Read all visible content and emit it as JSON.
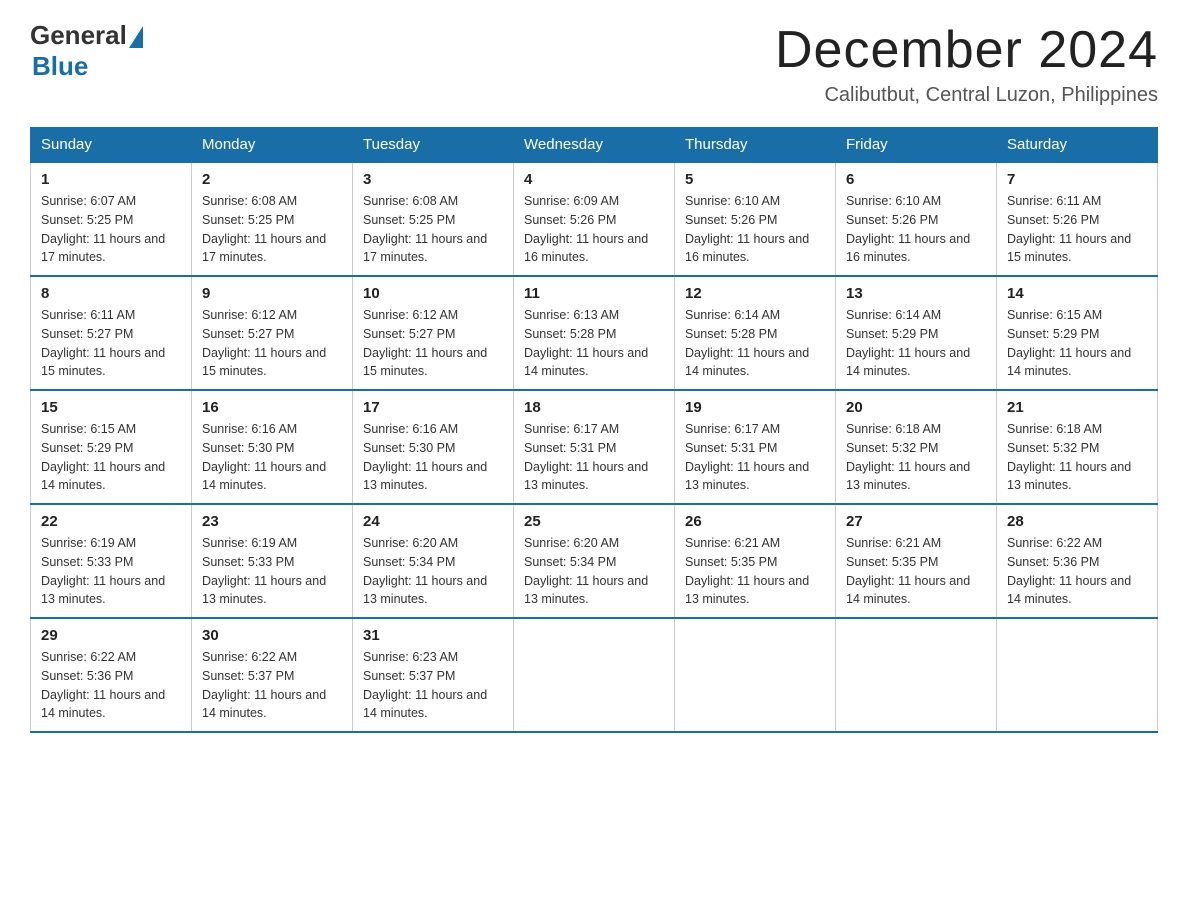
{
  "logo": {
    "general": "General",
    "blue": "Blue"
  },
  "header": {
    "month": "December 2024",
    "location": "Calibutbut, Central Luzon, Philippines"
  },
  "weekdays": [
    "Sunday",
    "Monday",
    "Tuesday",
    "Wednesday",
    "Thursday",
    "Friday",
    "Saturday"
  ],
  "weeks": [
    [
      {
        "day": "1",
        "sunrise": "6:07 AM",
        "sunset": "5:25 PM",
        "daylight": "11 hours and 17 minutes."
      },
      {
        "day": "2",
        "sunrise": "6:08 AM",
        "sunset": "5:25 PM",
        "daylight": "11 hours and 17 minutes."
      },
      {
        "day": "3",
        "sunrise": "6:08 AM",
        "sunset": "5:25 PM",
        "daylight": "11 hours and 17 minutes."
      },
      {
        "day": "4",
        "sunrise": "6:09 AM",
        "sunset": "5:26 PM",
        "daylight": "11 hours and 16 minutes."
      },
      {
        "day": "5",
        "sunrise": "6:10 AM",
        "sunset": "5:26 PM",
        "daylight": "11 hours and 16 minutes."
      },
      {
        "day": "6",
        "sunrise": "6:10 AM",
        "sunset": "5:26 PM",
        "daylight": "11 hours and 16 minutes."
      },
      {
        "day": "7",
        "sunrise": "6:11 AM",
        "sunset": "5:26 PM",
        "daylight": "11 hours and 15 minutes."
      }
    ],
    [
      {
        "day": "8",
        "sunrise": "6:11 AM",
        "sunset": "5:27 PM",
        "daylight": "11 hours and 15 minutes."
      },
      {
        "day": "9",
        "sunrise": "6:12 AM",
        "sunset": "5:27 PM",
        "daylight": "11 hours and 15 minutes."
      },
      {
        "day": "10",
        "sunrise": "6:12 AM",
        "sunset": "5:27 PM",
        "daylight": "11 hours and 15 minutes."
      },
      {
        "day": "11",
        "sunrise": "6:13 AM",
        "sunset": "5:28 PM",
        "daylight": "11 hours and 14 minutes."
      },
      {
        "day": "12",
        "sunrise": "6:14 AM",
        "sunset": "5:28 PM",
        "daylight": "11 hours and 14 minutes."
      },
      {
        "day": "13",
        "sunrise": "6:14 AM",
        "sunset": "5:29 PM",
        "daylight": "11 hours and 14 minutes."
      },
      {
        "day": "14",
        "sunrise": "6:15 AM",
        "sunset": "5:29 PM",
        "daylight": "11 hours and 14 minutes."
      }
    ],
    [
      {
        "day": "15",
        "sunrise": "6:15 AM",
        "sunset": "5:29 PM",
        "daylight": "11 hours and 14 minutes."
      },
      {
        "day": "16",
        "sunrise": "6:16 AM",
        "sunset": "5:30 PM",
        "daylight": "11 hours and 14 minutes."
      },
      {
        "day": "17",
        "sunrise": "6:16 AM",
        "sunset": "5:30 PM",
        "daylight": "11 hours and 13 minutes."
      },
      {
        "day": "18",
        "sunrise": "6:17 AM",
        "sunset": "5:31 PM",
        "daylight": "11 hours and 13 minutes."
      },
      {
        "day": "19",
        "sunrise": "6:17 AM",
        "sunset": "5:31 PM",
        "daylight": "11 hours and 13 minutes."
      },
      {
        "day": "20",
        "sunrise": "6:18 AM",
        "sunset": "5:32 PM",
        "daylight": "11 hours and 13 minutes."
      },
      {
        "day": "21",
        "sunrise": "6:18 AM",
        "sunset": "5:32 PM",
        "daylight": "11 hours and 13 minutes."
      }
    ],
    [
      {
        "day": "22",
        "sunrise": "6:19 AM",
        "sunset": "5:33 PM",
        "daylight": "11 hours and 13 minutes."
      },
      {
        "day": "23",
        "sunrise": "6:19 AM",
        "sunset": "5:33 PM",
        "daylight": "11 hours and 13 minutes."
      },
      {
        "day": "24",
        "sunrise": "6:20 AM",
        "sunset": "5:34 PM",
        "daylight": "11 hours and 13 minutes."
      },
      {
        "day": "25",
        "sunrise": "6:20 AM",
        "sunset": "5:34 PM",
        "daylight": "11 hours and 13 minutes."
      },
      {
        "day": "26",
        "sunrise": "6:21 AM",
        "sunset": "5:35 PM",
        "daylight": "11 hours and 13 minutes."
      },
      {
        "day": "27",
        "sunrise": "6:21 AM",
        "sunset": "5:35 PM",
        "daylight": "11 hours and 14 minutes."
      },
      {
        "day": "28",
        "sunrise": "6:22 AM",
        "sunset": "5:36 PM",
        "daylight": "11 hours and 14 minutes."
      }
    ],
    [
      {
        "day": "29",
        "sunrise": "6:22 AM",
        "sunset": "5:36 PM",
        "daylight": "11 hours and 14 minutes."
      },
      {
        "day": "30",
        "sunrise": "6:22 AM",
        "sunset": "5:37 PM",
        "daylight": "11 hours and 14 minutes."
      },
      {
        "day": "31",
        "sunrise": "6:23 AM",
        "sunset": "5:37 PM",
        "daylight": "11 hours and 14 minutes."
      },
      null,
      null,
      null,
      null
    ]
  ],
  "labels": {
    "sunrise_prefix": "Sunrise: ",
    "sunset_prefix": "Sunset: ",
    "daylight_prefix": "Daylight: "
  }
}
